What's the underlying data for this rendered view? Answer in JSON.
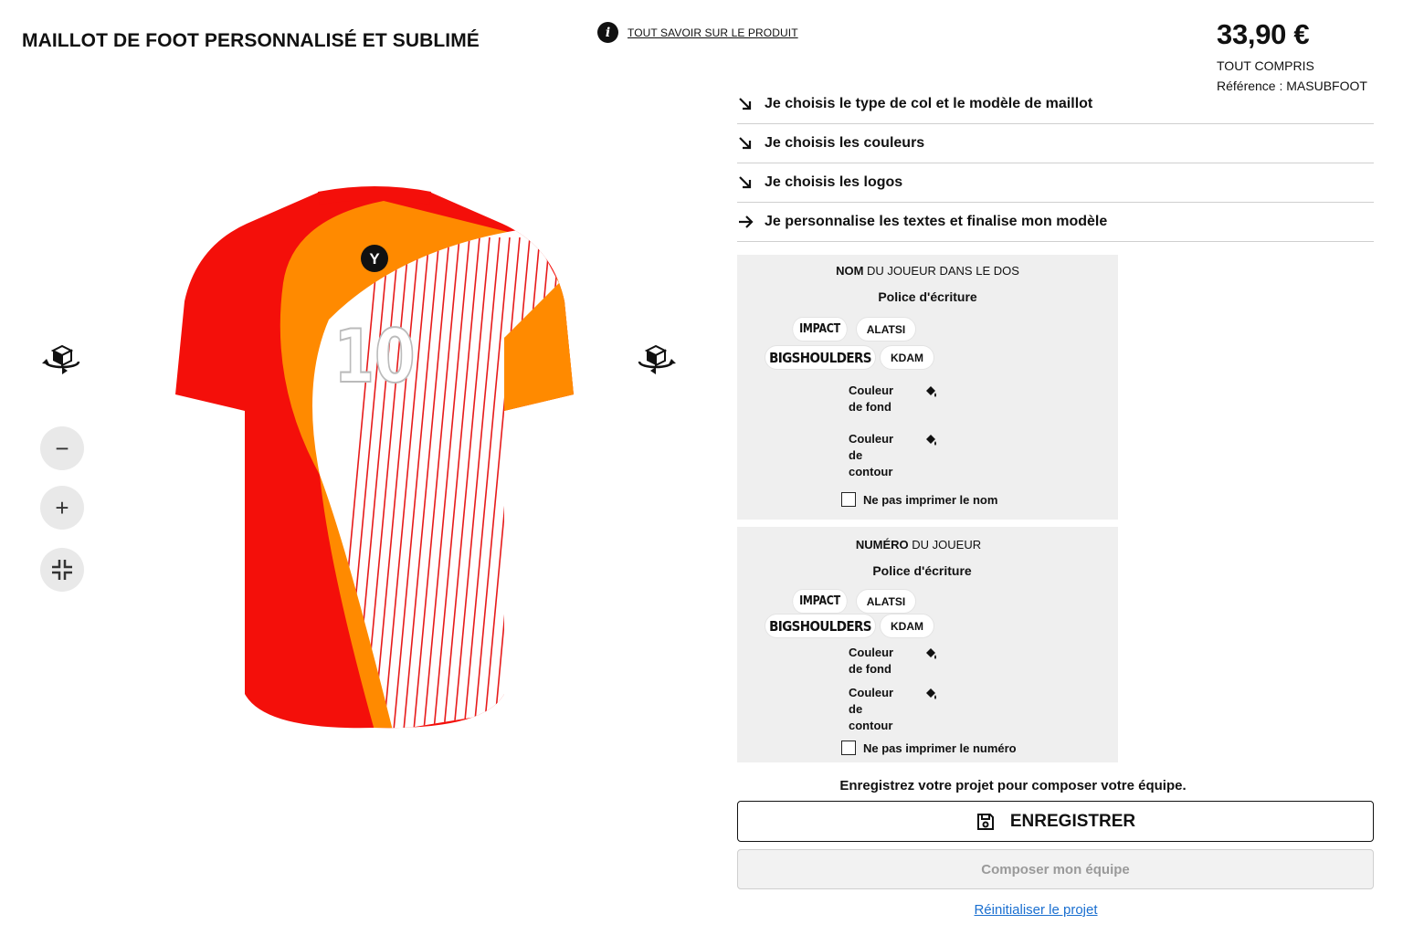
{
  "header": {
    "product_title": "MAILLOT DE FOOT PERSONNALISÉ ET SUBLIMÉ",
    "info_link": "TOUT SAVOIR SUR LE PRODUIT"
  },
  "price": {
    "amount": "33,90 €",
    "note": "TOUT COMPRIS",
    "reference": "Référence : MASUBFOOT"
  },
  "viewer": {
    "zoom_out": "−",
    "zoom_in": "+",
    "jersey_number": "10",
    "jersey_logo": "Y",
    "colors": {
      "red": "#f40f0a",
      "orange": "#ff8a00",
      "white": "#ffffff",
      "stripe": "#e61b1b"
    }
  },
  "steps": [
    {
      "label": "Je choisis le type de col et le modèle de maillot",
      "icon": "arrow-down-right-icon"
    },
    {
      "label": "Je choisis les couleurs",
      "icon": "arrow-down-right-icon"
    },
    {
      "label": "Je choisis les logos",
      "icon": "arrow-down-right-icon"
    },
    {
      "label": "Je personnalise les textes et finalise mon modèle",
      "icon": "arrow-right-icon"
    }
  ],
  "name_panel": {
    "heading_bold": "NOM",
    "heading_rest": " DU JOUEUR DANS LE DOS",
    "font_label": "Police d'écriture",
    "fonts": [
      "IMPACT",
      "ALATSI",
      "BIGSHOULDERS",
      "KDAM"
    ],
    "bg_color_label_1": "Couleur",
    "bg_color_label_2": "de fond",
    "outline_label_1": "Couleur",
    "outline_label_2": "de",
    "outline_label_3": "contour",
    "checkbox_label": "Ne pas imprimer le nom"
  },
  "number_panel": {
    "heading_bold": "NUMÉRO",
    "heading_rest": " DU JOUEUR",
    "font_label": "Police d'écriture",
    "fonts": [
      "IMPACT",
      "ALATSI",
      "BIGSHOULDERS",
      "KDAM"
    ],
    "bg_color_label_1": "Couleur",
    "bg_color_label_2": "de fond",
    "outline_label_1": "Couleur",
    "outline_label_2": "de",
    "outline_label_3": "contour",
    "checkbox_label": "Ne pas imprimer le numéro"
  },
  "actions": {
    "save_hint": "Enregistrez votre projet pour composer votre équipe.",
    "save_label": "ENREGISTRER",
    "compose_label": "Composer mon équipe",
    "reset_label": "Réinitialiser le projet"
  }
}
